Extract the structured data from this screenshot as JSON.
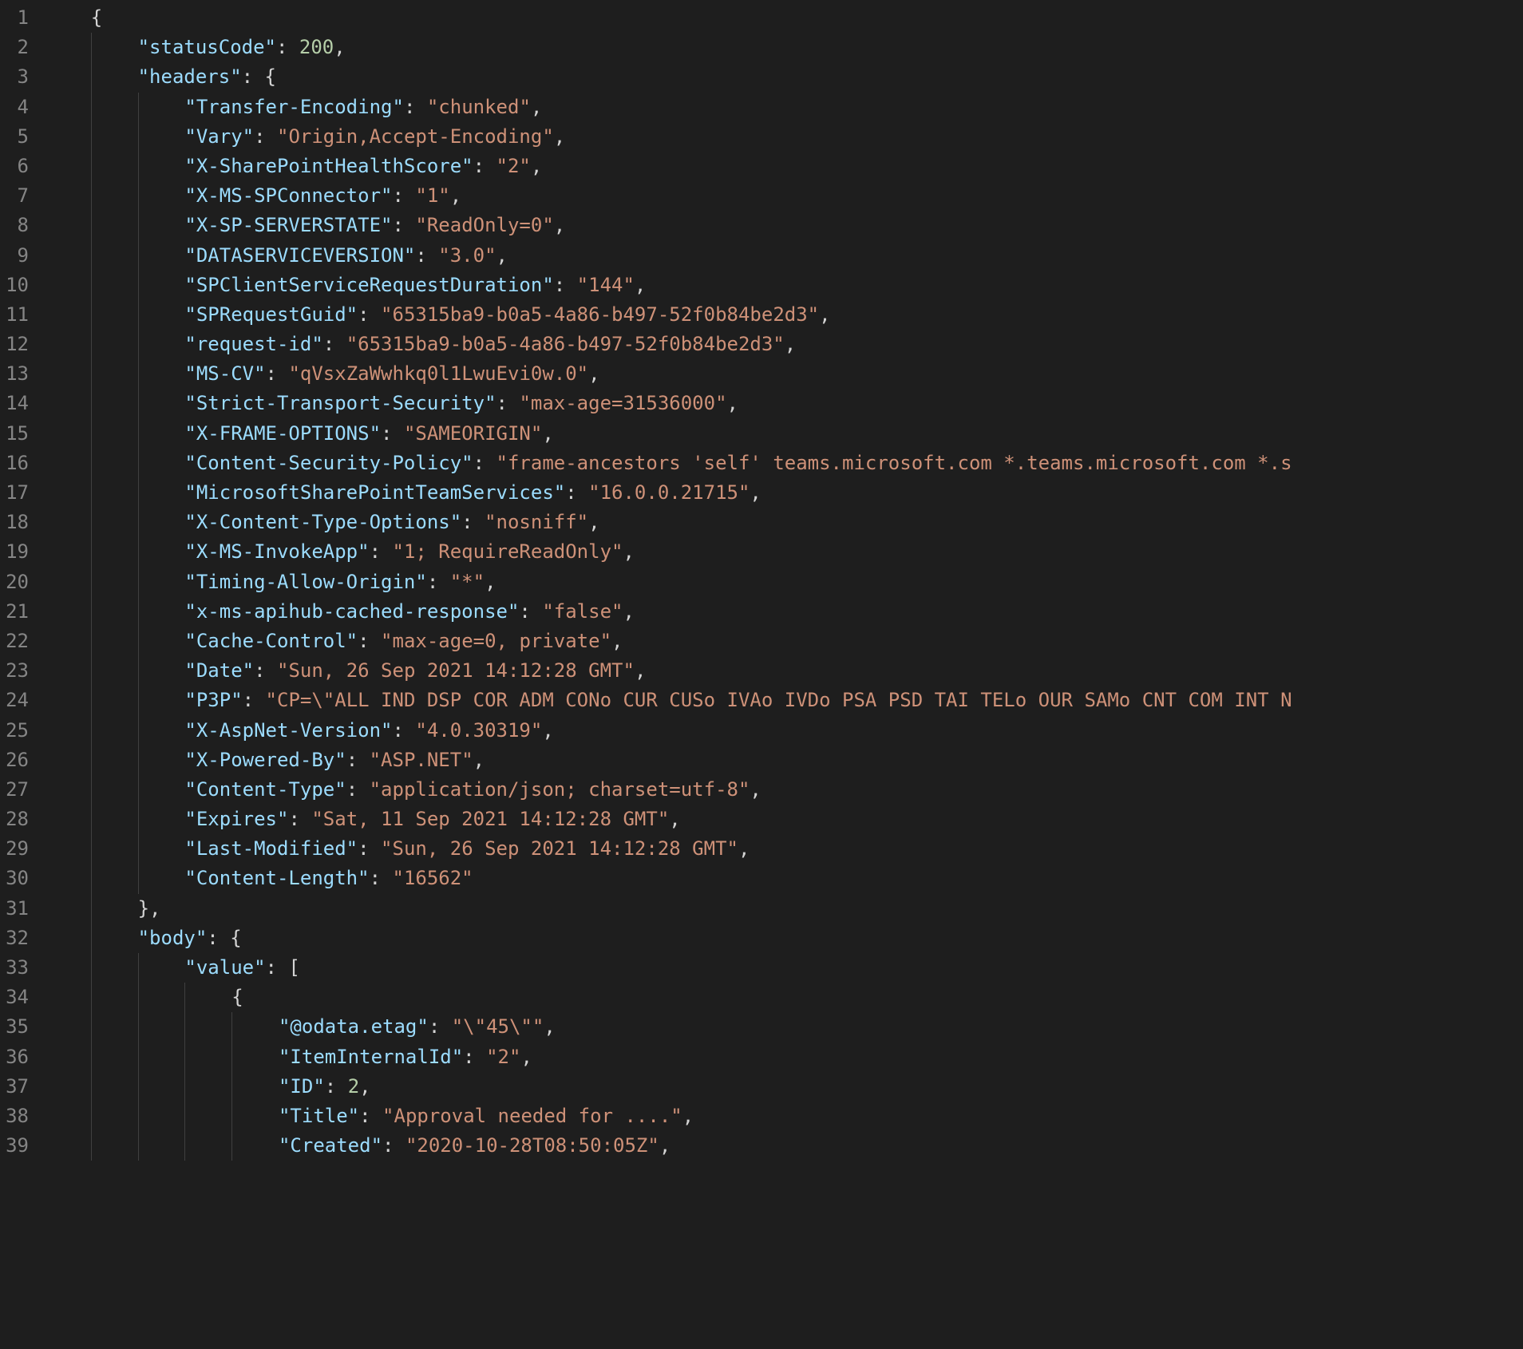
{
  "lines": [
    {
      "num": "1",
      "indent": 1,
      "tokens": [
        {
          "t": "brace",
          "v": "{"
        }
      ]
    },
    {
      "num": "2",
      "indent": 2,
      "tokens": [
        {
          "t": "key",
          "v": "\"statusCode\""
        },
        {
          "t": "punct",
          "v": ": "
        },
        {
          "t": "number",
          "v": "200"
        },
        {
          "t": "punct",
          "v": ","
        }
      ]
    },
    {
      "num": "3",
      "indent": 2,
      "tokens": [
        {
          "t": "key",
          "v": "\"headers\""
        },
        {
          "t": "punct",
          "v": ": "
        },
        {
          "t": "brace",
          "v": "{"
        }
      ]
    },
    {
      "num": "4",
      "indent": 3,
      "tokens": [
        {
          "t": "key",
          "v": "\"Transfer-Encoding\""
        },
        {
          "t": "punct",
          "v": ": "
        },
        {
          "t": "string",
          "v": "\"chunked\""
        },
        {
          "t": "punct",
          "v": ","
        }
      ]
    },
    {
      "num": "5",
      "indent": 3,
      "tokens": [
        {
          "t": "key",
          "v": "\"Vary\""
        },
        {
          "t": "punct",
          "v": ": "
        },
        {
          "t": "string",
          "v": "\"Origin,Accept-Encoding\""
        },
        {
          "t": "punct",
          "v": ","
        }
      ]
    },
    {
      "num": "6",
      "indent": 3,
      "tokens": [
        {
          "t": "key",
          "v": "\"X-SharePointHealthScore\""
        },
        {
          "t": "punct",
          "v": ": "
        },
        {
          "t": "string",
          "v": "\"2\""
        },
        {
          "t": "punct",
          "v": ","
        }
      ]
    },
    {
      "num": "7",
      "indent": 3,
      "tokens": [
        {
          "t": "key",
          "v": "\"X-MS-SPConnector\""
        },
        {
          "t": "punct",
          "v": ": "
        },
        {
          "t": "string",
          "v": "\"1\""
        },
        {
          "t": "punct",
          "v": ","
        }
      ]
    },
    {
      "num": "8",
      "indent": 3,
      "tokens": [
        {
          "t": "key",
          "v": "\"X-SP-SERVERSTATE\""
        },
        {
          "t": "punct",
          "v": ": "
        },
        {
          "t": "string",
          "v": "\"ReadOnly=0\""
        },
        {
          "t": "punct",
          "v": ","
        }
      ]
    },
    {
      "num": "9",
      "indent": 3,
      "tokens": [
        {
          "t": "key",
          "v": "\"DATASERVICEVERSION\""
        },
        {
          "t": "punct",
          "v": ": "
        },
        {
          "t": "string",
          "v": "\"3.0\""
        },
        {
          "t": "punct",
          "v": ","
        }
      ]
    },
    {
      "num": "10",
      "indent": 3,
      "tokens": [
        {
          "t": "key",
          "v": "\"SPClientServiceRequestDuration\""
        },
        {
          "t": "punct",
          "v": ": "
        },
        {
          "t": "string",
          "v": "\"144\""
        },
        {
          "t": "punct",
          "v": ","
        }
      ]
    },
    {
      "num": "11",
      "indent": 3,
      "tokens": [
        {
          "t": "key",
          "v": "\"SPRequestGuid\""
        },
        {
          "t": "punct",
          "v": ": "
        },
        {
          "t": "string",
          "v": "\"65315ba9-b0a5-4a86-b497-52f0b84be2d3\""
        },
        {
          "t": "punct",
          "v": ","
        }
      ]
    },
    {
      "num": "12",
      "indent": 3,
      "tokens": [
        {
          "t": "key",
          "v": "\"request-id\""
        },
        {
          "t": "punct",
          "v": ": "
        },
        {
          "t": "string",
          "v": "\"65315ba9-b0a5-4a86-b497-52f0b84be2d3\""
        },
        {
          "t": "punct",
          "v": ","
        }
      ]
    },
    {
      "num": "13",
      "indent": 3,
      "tokens": [
        {
          "t": "key",
          "v": "\"MS-CV\""
        },
        {
          "t": "punct",
          "v": ": "
        },
        {
          "t": "string",
          "v": "\"qVsxZaWwhkq0l1LwuEvi0w.0\""
        },
        {
          "t": "punct",
          "v": ","
        }
      ]
    },
    {
      "num": "14",
      "indent": 3,
      "tokens": [
        {
          "t": "key",
          "v": "\"Strict-Transport-Security\""
        },
        {
          "t": "punct",
          "v": ": "
        },
        {
          "t": "string",
          "v": "\"max-age=31536000\""
        },
        {
          "t": "punct",
          "v": ","
        }
      ]
    },
    {
      "num": "15",
      "indent": 3,
      "tokens": [
        {
          "t": "key",
          "v": "\"X-FRAME-OPTIONS\""
        },
        {
          "t": "punct",
          "v": ": "
        },
        {
          "t": "string",
          "v": "\"SAMEORIGIN\""
        },
        {
          "t": "punct",
          "v": ","
        }
      ]
    },
    {
      "num": "16",
      "indent": 3,
      "tokens": [
        {
          "t": "key",
          "v": "\"Content-Security-Policy\""
        },
        {
          "t": "punct",
          "v": ": "
        },
        {
          "t": "string",
          "v": "\"frame-ancestors 'self' teams.microsoft.com *.teams.microsoft.com *.s"
        }
      ]
    },
    {
      "num": "17",
      "indent": 3,
      "tokens": [
        {
          "t": "key",
          "v": "\"MicrosoftSharePointTeamServices\""
        },
        {
          "t": "punct",
          "v": ": "
        },
        {
          "t": "string",
          "v": "\"16.0.0.21715\""
        },
        {
          "t": "punct",
          "v": ","
        }
      ]
    },
    {
      "num": "18",
      "indent": 3,
      "tokens": [
        {
          "t": "key",
          "v": "\"X-Content-Type-Options\""
        },
        {
          "t": "punct",
          "v": ": "
        },
        {
          "t": "string",
          "v": "\"nosniff\""
        },
        {
          "t": "punct",
          "v": ","
        }
      ]
    },
    {
      "num": "19",
      "indent": 3,
      "tokens": [
        {
          "t": "key",
          "v": "\"X-MS-InvokeApp\""
        },
        {
          "t": "punct",
          "v": ": "
        },
        {
          "t": "string",
          "v": "\"1; RequireReadOnly\""
        },
        {
          "t": "punct",
          "v": ","
        }
      ]
    },
    {
      "num": "20",
      "indent": 3,
      "tokens": [
        {
          "t": "key",
          "v": "\"Timing-Allow-Origin\""
        },
        {
          "t": "punct",
          "v": ": "
        },
        {
          "t": "string",
          "v": "\"*\""
        },
        {
          "t": "punct",
          "v": ","
        }
      ]
    },
    {
      "num": "21",
      "indent": 3,
      "tokens": [
        {
          "t": "key",
          "v": "\"x-ms-apihub-cached-response\""
        },
        {
          "t": "punct",
          "v": ": "
        },
        {
          "t": "string",
          "v": "\"false\""
        },
        {
          "t": "punct",
          "v": ","
        }
      ]
    },
    {
      "num": "22",
      "indent": 3,
      "tokens": [
        {
          "t": "key",
          "v": "\"Cache-Control\""
        },
        {
          "t": "punct",
          "v": ": "
        },
        {
          "t": "string",
          "v": "\"max-age=0, private\""
        },
        {
          "t": "punct",
          "v": ","
        }
      ]
    },
    {
      "num": "23",
      "indent": 3,
      "tokens": [
        {
          "t": "key",
          "v": "\"Date\""
        },
        {
          "t": "punct",
          "v": ": "
        },
        {
          "t": "string",
          "v": "\"Sun, 26 Sep 2021 14:12:28 GMT\""
        },
        {
          "t": "punct",
          "v": ","
        }
      ]
    },
    {
      "num": "24",
      "indent": 3,
      "tokens": [
        {
          "t": "key",
          "v": "\"P3P\""
        },
        {
          "t": "punct",
          "v": ": "
        },
        {
          "t": "string",
          "v": "\"CP=\\\"ALL IND DSP COR ADM CONo CUR CUSo IVAo IVDo PSA PSD TAI TELo OUR SAMo CNT COM INT N"
        }
      ]
    },
    {
      "num": "25",
      "indent": 3,
      "tokens": [
        {
          "t": "key",
          "v": "\"X-AspNet-Version\""
        },
        {
          "t": "punct",
          "v": ": "
        },
        {
          "t": "string",
          "v": "\"4.0.30319\""
        },
        {
          "t": "punct",
          "v": ","
        }
      ]
    },
    {
      "num": "26",
      "indent": 3,
      "tokens": [
        {
          "t": "key",
          "v": "\"X-Powered-By\""
        },
        {
          "t": "punct",
          "v": ": "
        },
        {
          "t": "string",
          "v": "\"ASP.NET\""
        },
        {
          "t": "punct",
          "v": ","
        }
      ]
    },
    {
      "num": "27",
      "indent": 3,
      "tokens": [
        {
          "t": "key",
          "v": "\"Content-Type\""
        },
        {
          "t": "punct",
          "v": ": "
        },
        {
          "t": "string",
          "v": "\"application/json; charset=utf-8\""
        },
        {
          "t": "punct",
          "v": ","
        }
      ]
    },
    {
      "num": "28",
      "indent": 3,
      "tokens": [
        {
          "t": "key",
          "v": "\"Expires\""
        },
        {
          "t": "punct",
          "v": ": "
        },
        {
          "t": "string",
          "v": "\"Sat, 11 Sep 2021 14:12:28 GMT\""
        },
        {
          "t": "punct",
          "v": ","
        }
      ]
    },
    {
      "num": "29",
      "indent": 3,
      "tokens": [
        {
          "t": "key",
          "v": "\"Last-Modified\""
        },
        {
          "t": "punct",
          "v": ": "
        },
        {
          "t": "string",
          "v": "\"Sun, 26 Sep 2021 14:12:28 GMT\""
        },
        {
          "t": "punct",
          "v": ","
        }
      ]
    },
    {
      "num": "30",
      "indent": 3,
      "tokens": [
        {
          "t": "key",
          "v": "\"Content-Length\""
        },
        {
          "t": "punct",
          "v": ": "
        },
        {
          "t": "string",
          "v": "\"16562\""
        }
      ]
    },
    {
      "num": "31",
      "indent": 2,
      "tokens": [
        {
          "t": "brace",
          "v": "}"
        },
        {
          "t": "punct",
          "v": ","
        }
      ]
    },
    {
      "num": "32",
      "indent": 2,
      "tokens": [
        {
          "t": "key",
          "v": "\"body\""
        },
        {
          "t": "punct",
          "v": ": "
        },
        {
          "t": "brace",
          "v": "{"
        }
      ]
    },
    {
      "num": "33",
      "indent": 3,
      "tokens": [
        {
          "t": "key",
          "v": "\"value\""
        },
        {
          "t": "punct",
          "v": ": "
        },
        {
          "t": "brace",
          "v": "["
        }
      ]
    },
    {
      "num": "34",
      "indent": 4,
      "tokens": [
        {
          "t": "brace",
          "v": "{"
        }
      ]
    },
    {
      "num": "35",
      "indent": 5,
      "tokens": [
        {
          "t": "key",
          "v": "\"@odata.etag\""
        },
        {
          "t": "punct",
          "v": ": "
        },
        {
          "t": "string",
          "v": "\"\\\"45\\\"\""
        },
        {
          "t": "punct",
          "v": ","
        }
      ]
    },
    {
      "num": "36",
      "indent": 5,
      "tokens": [
        {
          "t": "key",
          "v": "\"ItemInternalId\""
        },
        {
          "t": "punct",
          "v": ": "
        },
        {
          "t": "string",
          "v": "\"2\""
        },
        {
          "t": "punct",
          "v": ","
        }
      ]
    },
    {
      "num": "37",
      "indent": 5,
      "tokens": [
        {
          "t": "key",
          "v": "\"ID\""
        },
        {
          "t": "punct",
          "v": ": "
        },
        {
          "t": "number",
          "v": "2"
        },
        {
          "t": "punct",
          "v": ","
        }
      ]
    },
    {
      "num": "38",
      "indent": 5,
      "tokens": [
        {
          "t": "key",
          "v": "\"Title\""
        },
        {
          "t": "punct",
          "v": ": "
        },
        {
          "t": "string",
          "v": "\"Approval needed for ....\""
        },
        {
          "t": "punct",
          "v": ","
        }
      ]
    },
    {
      "num": "39",
      "indent": 5,
      "tokens": [
        {
          "t": "key",
          "v": "\"Created\""
        },
        {
          "t": "punct",
          "v": ": "
        },
        {
          "t": "string",
          "v": "\"2020-10-28T08:50:05Z\""
        },
        {
          "t": "punct",
          "v": ","
        }
      ]
    }
  ]
}
